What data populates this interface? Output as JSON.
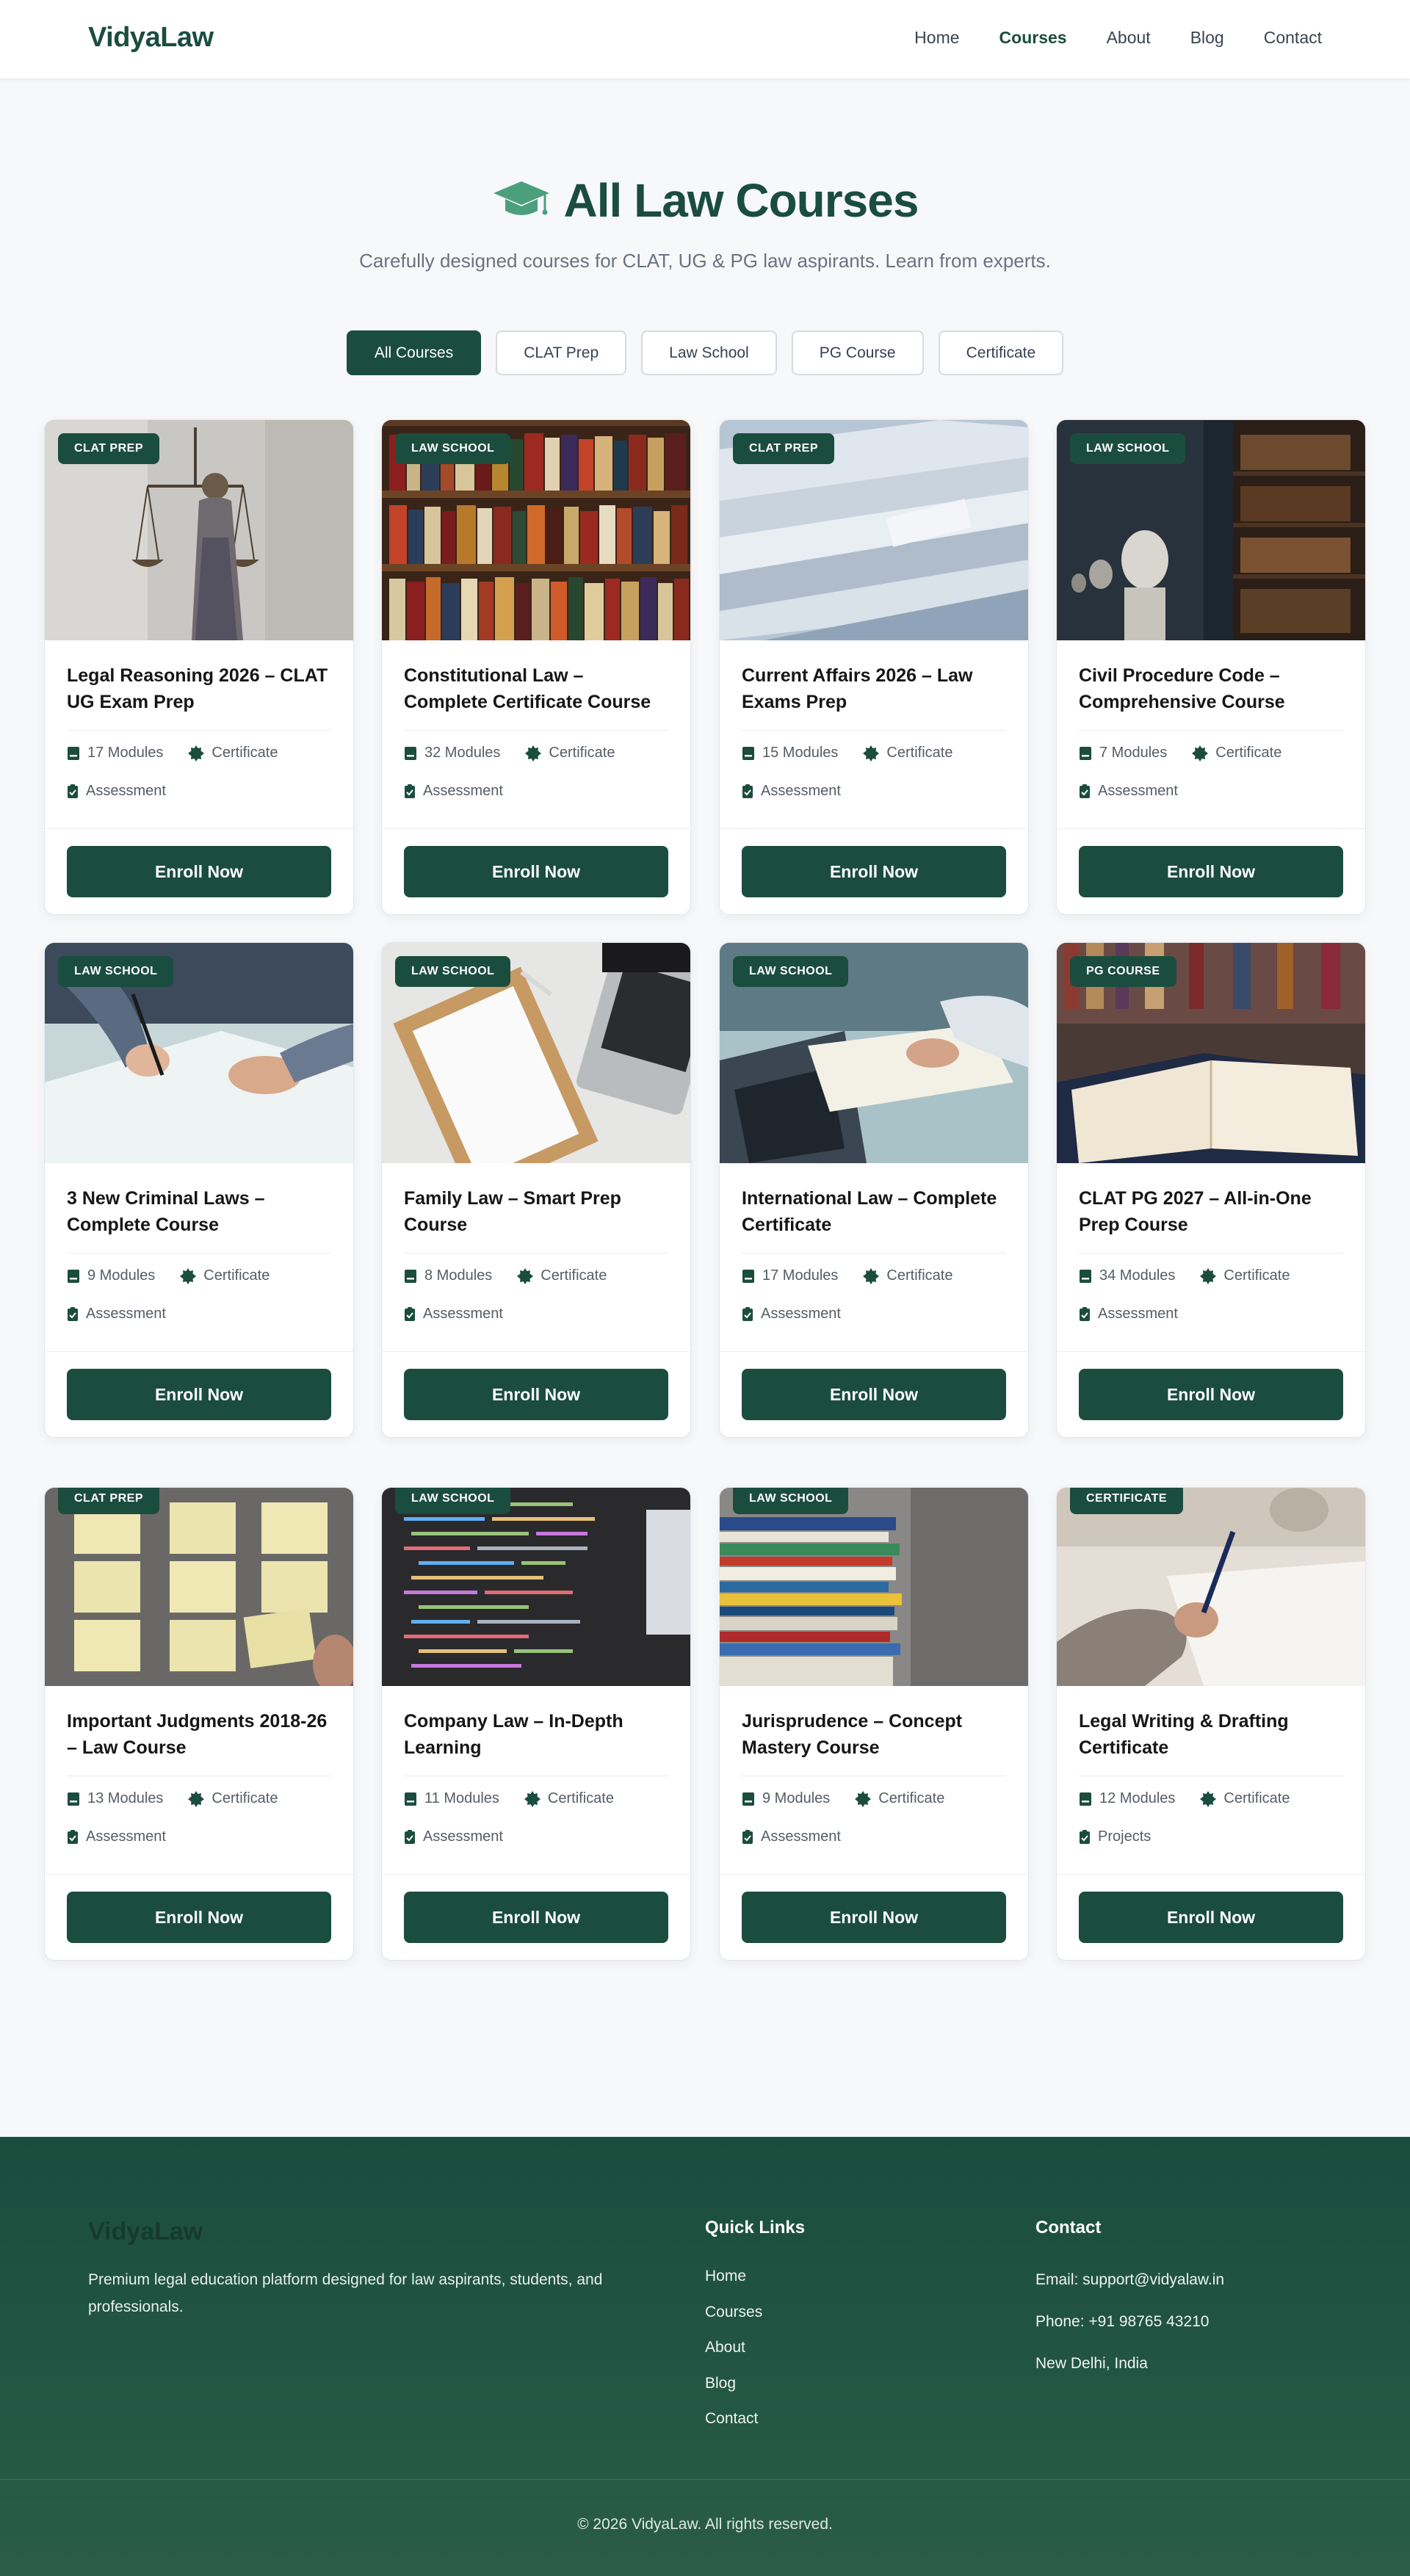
{
  "brand": "VidyaLaw",
  "nav": [
    {
      "label": "Home",
      "active": false
    },
    {
      "label": "Courses",
      "active": true
    },
    {
      "label": "About",
      "active": false
    },
    {
      "label": "Blog",
      "active": false
    },
    {
      "label": "Contact",
      "active": false
    }
  ],
  "hero": {
    "icon": "graduation-cap-icon",
    "title": "All Law Courses",
    "subtitle": "Carefully designed courses for CLAT, UG & PG law aspirants. Learn from experts."
  },
  "filters": [
    {
      "label": "All Courses",
      "active": true
    },
    {
      "label": "CLAT Prep",
      "active": false
    },
    {
      "label": "Law School",
      "active": false
    },
    {
      "label": "PG Course",
      "active": false
    },
    {
      "label": "Certificate",
      "active": false
    }
  ],
  "enroll_label": "Enroll Now",
  "courses": [
    {
      "badge": "CLAT PREP",
      "title": "Legal Reasoning 2026 – CLAT UG Exam Prep",
      "modules": "17 Modules",
      "feature": "Certificate",
      "extra": "Assessment",
      "image": "lady-justice-statue"
    },
    {
      "badge": "LAW SCHOOL",
      "title": "Constitutional Law – Complete Certificate Course",
      "modules": "32 Modules",
      "feature": "Certificate",
      "extra": "Assessment",
      "image": "bookshelf"
    },
    {
      "badge": "CLAT PREP",
      "title": "Current Affairs 2026 – Law Exams Prep",
      "modules": "15 Modules",
      "feature": "Certificate",
      "extra": "Assessment",
      "image": "newspapers"
    },
    {
      "badge": "LAW SCHOOL",
      "title": "Civil Procedure Code – Comprehensive Course",
      "modules": "7 Modules",
      "feature": "Certificate",
      "extra": "Assessment",
      "image": "library-busts"
    },
    {
      "badge": "LAW SCHOOL",
      "title": "3 New Criminal Laws – Complete Course",
      "modules": "9 Modules",
      "feature": "Certificate",
      "extra": "Assessment",
      "image": "signing-document"
    },
    {
      "badge": "LAW SCHOOL",
      "title": "Family Law – Smart Prep Course",
      "modules": "8 Modules",
      "feature": "Certificate",
      "extra": "Assessment",
      "image": "clipboard-laptop"
    },
    {
      "badge": "LAW SCHOOL",
      "title": "International Law – Complete Certificate",
      "modules": "17 Modules",
      "feature": "Certificate",
      "extra": "Assessment",
      "image": "laptop-notes"
    },
    {
      "badge": "PG COURSE",
      "title": "CLAT PG 2027 – All-in-One Prep Course",
      "modules": "34 Modules",
      "feature": "Certificate",
      "extra": "Assessment",
      "image": "open-book"
    },
    {
      "badge": "CLAT PREP",
      "title": "Important Judgments 2018-26 – Law Course",
      "modules": "13 Modules",
      "feature": "Certificate",
      "extra": "Assessment",
      "image": "sticky-notes"
    },
    {
      "badge": "LAW SCHOOL",
      "title": "Company Law – In-Depth Learning",
      "modules": "11 Modules",
      "feature": "Certificate",
      "extra": "Assessment",
      "image": "code-screen"
    },
    {
      "badge": "LAW SCHOOL",
      "title": "Jurisprudence – Concept Mastery Course",
      "modules": "9 Modules",
      "feature": "Certificate",
      "extra": "Assessment",
      "image": "book-stack"
    },
    {
      "badge": "CERTIFICATE",
      "title": "Legal Writing & Drafting Certificate",
      "modules": "12 Modules",
      "feature": "Certificate",
      "extra": "Projects",
      "image": "hand-writing"
    }
  ],
  "footer": {
    "brand": "VidyaLaw",
    "description": "Premium legal education platform designed for law aspirants, students, and professionals.",
    "quick_links_title": "Quick Links",
    "quick_links": [
      "Home",
      "Courses",
      "About",
      "Blog",
      "Contact"
    ],
    "contact_title": "Contact",
    "email": "Email: support@vidyalaw.in",
    "phone": "Phone: +91 98765 43210",
    "location": "New Delhi, India",
    "copyright": "© 2026 VidyaLaw. All rights reserved."
  },
  "colors": {
    "primary": "#1b4d3e",
    "background": "#f7f8fa",
    "text_muted": "#6b7280"
  }
}
